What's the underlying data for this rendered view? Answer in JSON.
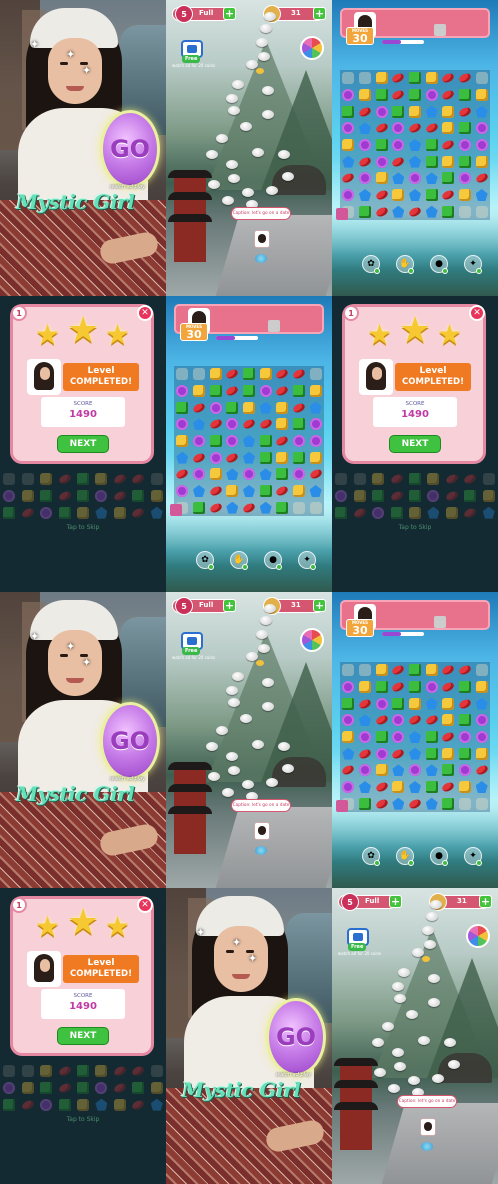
{
  "portrait": {
    "go_label": "GO",
    "watch_ad_label": "watch ad play",
    "brand": "Mystic Girl"
  },
  "map": {
    "level": "5",
    "lives_label": "Full",
    "coins": "31",
    "free_label": "Free",
    "watch_ad_label": "watch ad for 20 coins",
    "message": "Caption: let's go on a date",
    "icons": [
      "heart-icon",
      "coin-icon",
      "tv-icon",
      "wheel-icon",
      "plus-icon"
    ]
  },
  "board": {
    "moves_label": "MOVES",
    "moves": "30",
    "goal_count": "0",
    "progress_fraction": 0.45,
    "grid": [
      [
        5,
        5,
        0,
        1,
        2,
        0,
        1,
        1,
        5
      ],
      [
        3,
        0,
        2,
        1,
        2,
        3,
        1,
        2,
        0
      ],
      [
        2,
        1,
        3,
        2,
        0,
        4,
        0,
        1,
        4
      ],
      [
        3,
        4,
        1,
        3,
        1,
        1,
        0,
        2,
        3
      ],
      [
        0,
        3,
        2,
        3,
        4,
        2,
        1,
        3,
        3
      ],
      [
        4,
        1,
        3,
        1,
        4,
        2,
        0,
        2,
        0
      ],
      [
        1,
        3,
        0,
        4,
        3,
        4,
        2,
        3,
        1
      ],
      [
        3,
        4,
        1,
        0,
        4,
        2,
        1,
        0,
        4
      ],
      [
        5,
        2,
        1,
        4,
        1,
        4,
        2,
        5,
        5
      ]
    ],
    "boosters": [
      "bomb-icon",
      "hand-icon",
      "chocolate-icon",
      "candy-icon"
    ]
  },
  "complete": {
    "level_num": "1",
    "title_line1": "Level",
    "title_line2": "COMPLETED!",
    "score_label": "SCORE",
    "score": "1490",
    "stars_earned": 3,
    "next_label": "NEXT",
    "tap_label": "Tap to Skip"
  }
}
